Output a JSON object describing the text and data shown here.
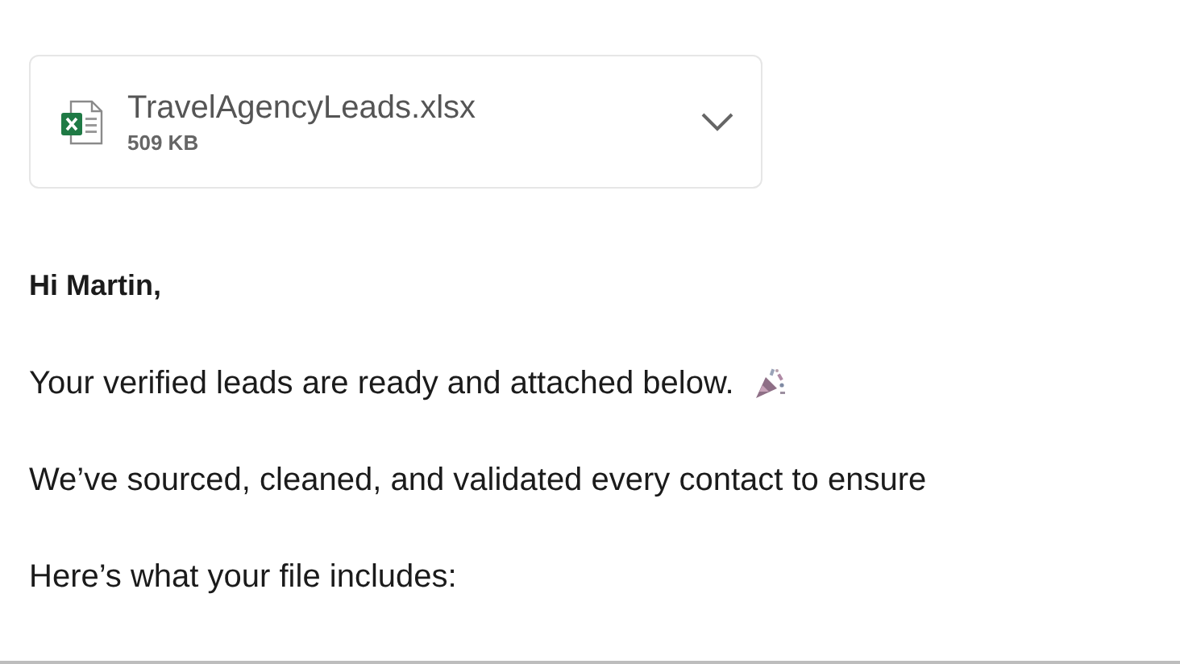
{
  "attachment": {
    "file_name": "TravelAgencyLeads.xlsx",
    "size": "509 KB"
  },
  "greeting": "Hi Martin,",
  "paragraphs": [
    {
      "text": "Your verified leads are ready and attached below.",
      "kind": "with_icon"
    },
    {
      "text": "We’ve sourced, cleaned, and validated every contact to ensure",
      "kind": "plain"
    },
    {
      "text": "Here’s what your file includes:",
      "kind": "plain"
    }
  ]
}
